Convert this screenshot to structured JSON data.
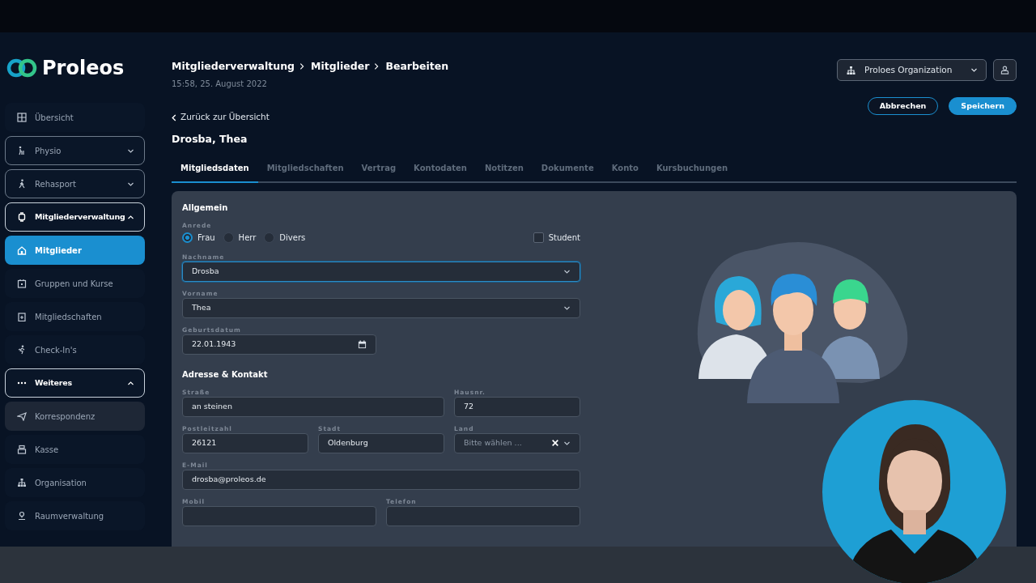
{
  "logo": {
    "text": "Proleos"
  },
  "sidebar": {
    "items": [
      {
        "label": "Übersicht",
        "kind": "link",
        "selected": false,
        "hovered": false
      },
      {
        "label": "Physio",
        "kind": "group",
        "expanded": false
      },
      {
        "label": "Rehasport",
        "kind": "group",
        "expanded": false
      },
      {
        "label": "Mitgliederverwaltung",
        "kind": "group",
        "expanded": true,
        "children": [
          {
            "label": "Mitglieder",
            "kind": "link",
            "selected": true,
            "hovered": false
          },
          {
            "label": "Gruppen und Kurse",
            "kind": "link",
            "selected": false,
            "hovered": false
          },
          {
            "label": "Mitgliedschaften",
            "kind": "link",
            "selected": false,
            "hovered": false
          },
          {
            "label": "Check-In's",
            "kind": "link",
            "selected": false,
            "hovered": false
          }
        ]
      },
      {
        "label": "Weiteres",
        "kind": "group",
        "expanded": true,
        "children": [
          {
            "label": "Korrespondenz",
            "kind": "link",
            "selected": false,
            "hovered": true
          },
          {
            "label": "Kasse",
            "kind": "link",
            "selected": false,
            "hovered": false
          },
          {
            "label": "Organisation",
            "kind": "link",
            "selected": false,
            "hovered": false
          },
          {
            "label": "Raumverwaltung",
            "kind": "link",
            "selected": false,
            "hovered": false
          }
        ]
      }
    ]
  },
  "header": {
    "breadcrumb": [
      "Mitgliederverwaltung",
      "Mitglieder",
      "Bearbeiten"
    ],
    "timestamp": "15:58, 25. August 2022",
    "organization": "Proloes Organization",
    "back_link": "Zurück zur Übersicht",
    "title": "Drosba, Thea",
    "buttons": [
      {
        "label": "Abbrechen",
        "kind": "outline"
      },
      {
        "label": "Speichern",
        "kind": "primary"
      }
    ]
  },
  "tabs": [
    {
      "label": "Mitgliedsdaten",
      "selected": true
    },
    {
      "label": "Mitgliedschaften",
      "selected": false
    },
    {
      "label": "Vertrag",
      "selected": false
    },
    {
      "label": "Kontodaten",
      "selected": false
    },
    {
      "label": "Notitzen",
      "selected": false
    },
    {
      "label": "Dokumente",
      "selected": false
    },
    {
      "label": "Konto",
      "selected": false
    },
    {
      "label": "Kursbuchungen",
      "selected": false
    }
  ],
  "general": {
    "title": "Allgemein",
    "salutation": {
      "label": "Anrede",
      "options": [
        {
          "label": "Frau",
          "selected": true
        },
        {
          "label": "Herr",
          "selected": false
        },
        {
          "label": "Divers",
          "selected": false
        }
      ]
    },
    "student": {
      "label": "Student",
      "checked": false
    },
    "last_name": {
      "label": "Nachname",
      "value": "Drosba",
      "focused": true
    },
    "first_name": {
      "label": "Vorname",
      "value": "Thea",
      "focused": false
    },
    "birth_date": {
      "label": "Geburtsdatum",
      "value": "22.01.1943"
    }
  },
  "address": {
    "title": "Adresse & Kontakt",
    "street": {
      "label": "Straße",
      "value": "an steinen"
    },
    "house_number": {
      "label": "Hausnr.",
      "value": "72"
    },
    "postal_code": {
      "label": "Postleitzahl",
      "value": "26121"
    },
    "city": {
      "label": "Stadt",
      "value": "Oldenburg"
    },
    "country": {
      "label": "Land",
      "placeholder": "Bitte wählen ..."
    },
    "email": {
      "label": "E-Mail",
      "value": "drosba@proleos.de"
    },
    "mobile": {
      "label": "Mobil"
    },
    "phone": {
      "label": "Telefon"
    }
  }
}
